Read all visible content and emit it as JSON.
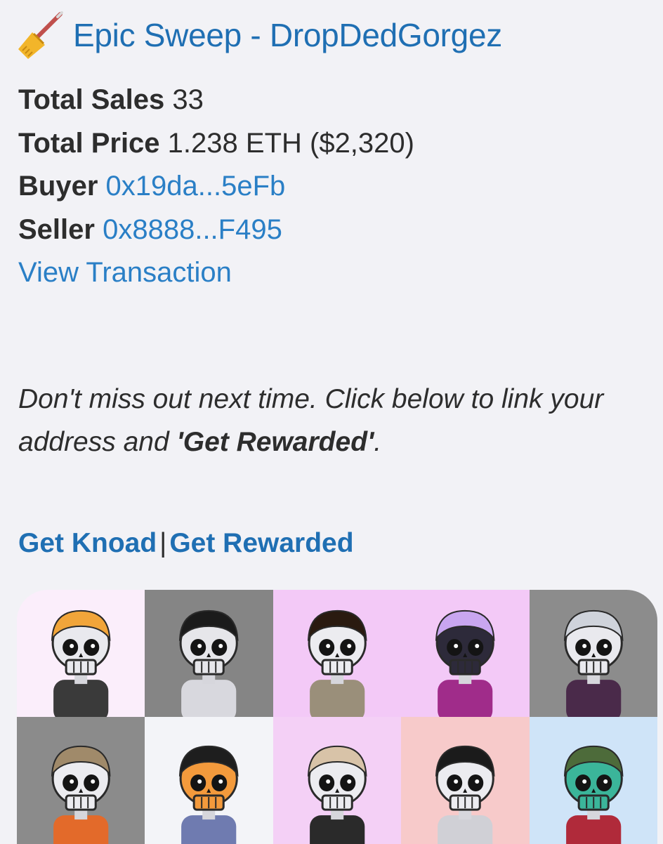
{
  "header": {
    "title": "Epic Sweep - DropDedGorgez",
    "icon": "broom-icon"
  },
  "stats": {
    "total_sales": {
      "label": "Total Sales",
      "value": "33"
    },
    "total_price": {
      "label": "Total Price",
      "value": "1.238 ETH ($2,320)"
    },
    "buyer": {
      "label": "Buyer",
      "value": "0x19da...5eFb"
    },
    "seller": {
      "label": "Seller",
      "value": "0x8888...F495"
    },
    "view_transaction": "View Transaction"
  },
  "promo": {
    "text_before": "Don't miss out next time. Click below to link your address and ",
    "emphasis": "'Get Rewarded'",
    "text_after": "."
  },
  "cta": {
    "get_knoad": "Get Knoad",
    "separator": "|",
    "get_rewarded": "Get Rewarded"
  },
  "colors": {
    "link": "#2a7fc6",
    "title": "#1f6fb3",
    "background": "#f2f2f6"
  },
  "nft_grid": {
    "tiles": [
      {
        "bg": "#fbeefb",
        "hair": "#f1a53a",
        "skull": "#e9e9ee",
        "outfit": "#3a3a3a",
        "icon": "skeleton-orange-hair"
      },
      {
        "bg": "#858585",
        "hair": "#1b1b1b",
        "skull": "#e6e6ea",
        "outfit": "#d8d8de",
        "icon": "skeleton-black-cap"
      },
      {
        "bg": "#f3c9f7",
        "hair": "#2a1a10",
        "skull": "#ececf0",
        "outfit": "#9a8f7a",
        "icon": "skeleton-afro"
      },
      {
        "bg": "#f3c9f7",
        "hair": "#c9a6f0",
        "skull": "#2d2a3a",
        "outfit": "#a02c8a",
        "icon": "skeleton-purple-bun"
      },
      {
        "bg": "#8c8c8c",
        "hair": "#cfd3db",
        "skull": "#e9e9ee",
        "outfit": "#4a2a4a",
        "icon": "skeleton-robot-helmet"
      },
      {
        "bg": "#8b8b8b",
        "hair": "#a08a6a",
        "skull": "#ececf0",
        "outfit": "#e36a2a",
        "icon": "skeleton-camo-helmet"
      },
      {
        "bg": "#f3f4f8",
        "hair": "#1e1e1e",
        "skull": "#f39a3c",
        "outfit": "#6f7bb0",
        "icon": "skeleton-orange-skull"
      },
      {
        "bg": "#f4d0f6",
        "hair": "#d8c3a8",
        "skull": "#ececf0",
        "outfit": "#2a2a2a",
        "icon": "skeleton-teal-jaw"
      },
      {
        "bg": "#f7caca",
        "hair": "#1b1b1b",
        "skull": "#ececf0",
        "outfit": "#d0d0d6",
        "icon": "skeleton-gold-visor"
      },
      {
        "bg": "#cfe4f8",
        "hair": "#4d6b3a",
        "skull": "#3bb59a",
        "outfit": "#b02a3a",
        "icon": "skeleton-army-cap"
      }
    ]
  }
}
